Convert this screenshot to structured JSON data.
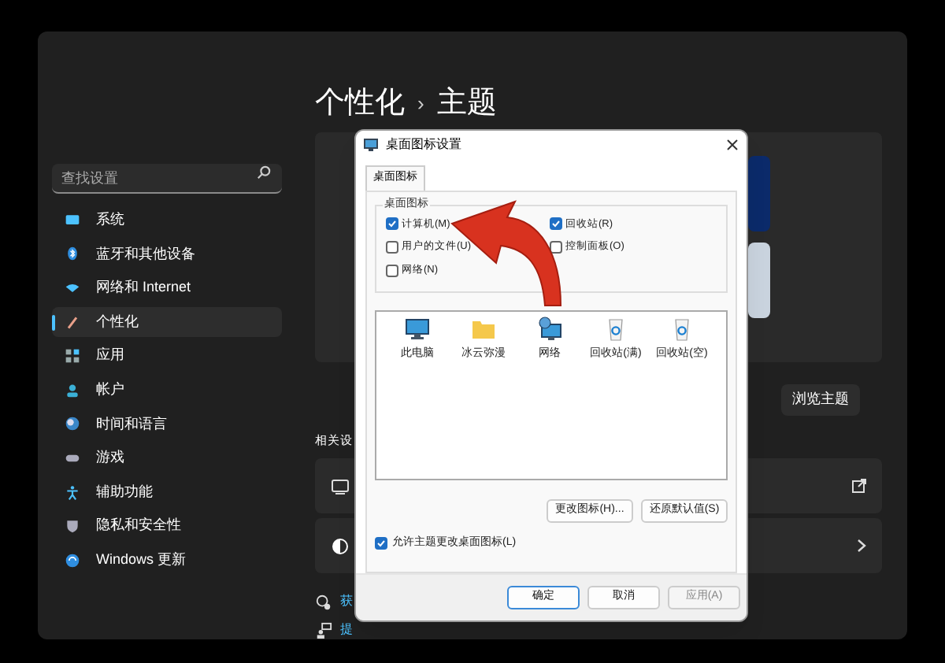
{
  "sidebar": {
    "search": {
      "placeholder": "查找设置"
    },
    "items": [
      {
        "label": "系统",
        "selected": false
      },
      {
        "label": "蓝牙和其他设备",
        "selected": false
      },
      {
        "label": "网络和 Internet",
        "selected": false
      },
      {
        "label": "个性化",
        "selected": true
      },
      {
        "label": "应用",
        "selected": false
      },
      {
        "label": "帐户",
        "selected": false
      },
      {
        "label": "时间和语言",
        "selected": false
      },
      {
        "label": "游戏",
        "selected": false
      },
      {
        "label": "辅助功能",
        "selected": false
      },
      {
        "label": "隐私和安全性",
        "selected": false
      },
      {
        "label": "Windows 更新",
        "selected": false
      }
    ]
  },
  "breadcrumb": {
    "items": [
      "个性化",
      "主题"
    ],
    "separator": "›"
  },
  "browse_button": "浏览主题",
  "related_heading": "相关设",
  "links": [
    {
      "label": "获"
    },
    {
      "label": "提"
    }
  ],
  "dialog": {
    "title": "桌面图标设置",
    "tabs": [
      {
        "label": "桌面图标",
        "selected": true
      }
    ],
    "group_title": "桌面图标",
    "checkboxes": [
      {
        "label": "计算机(M)",
        "checked": true
      },
      {
        "label": "回收站(R)",
        "checked": true
      },
      {
        "label": "用户的文件(U)",
        "checked": false
      },
      {
        "label": "控制面板(O)",
        "checked": false
      },
      {
        "label": "网络(N)",
        "checked": false
      }
    ],
    "icons": [
      {
        "kind": "pc",
        "label": "此电脑"
      },
      {
        "kind": "folder",
        "label": "冰云弥漫"
      },
      {
        "kind": "network",
        "label": "网络"
      },
      {
        "kind": "bin",
        "label": "回收站(满)"
      },
      {
        "kind": "bin",
        "label": "回收站(空)"
      }
    ],
    "actions": [
      "更改图标(H)...",
      "还原默认值(S)"
    ],
    "allow_themes": {
      "label": "允许主题更改桌面图标(L)",
      "checked": true
    },
    "buttons": [
      {
        "label": "确定",
        "default": true,
        "disabled": false
      },
      {
        "label": "取消",
        "default": false,
        "disabled": false
      },
      {
        "label": "应用(A)",
        "default": false,
        "disabled": true
      }
    ]
  }
}
